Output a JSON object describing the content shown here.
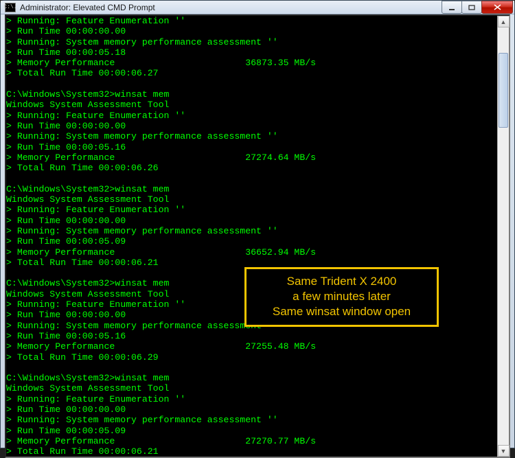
{
  "window": {
    "title": "Administrator: Elevated CMD Prompt",
    "icon_text": "C:\\."
  },
  "annotation": {
    "line1": "Same Trident X 2400",
    "line2": "a few minutes later",
    "line3": "Same winsat window open"
  },
  "runs": [
    {
      "prompt": null,
      "tool_line": null,
      "feat_time": "00:00:00.00",
      "assess_time": "00:00:05.18",
      "mem_perf": "36873.35 MB/s",
      "total_time": "00:00:06.27"
    },
    {
      "prompt": "C:\\Windows\\System32>winsat mem",
      "tool_line": "Windows System Assessment Tool",
      "feat_time": "00:00:00.00",
      "assess_time": "00:00:05.16",
      "mem_perf": "27274.64 MB/s",
      "total_time": "00:00:06.26"
    },
    {
      "prompt": "C:\\Windows\\System32>winsat mem",
      "tool_line": "Windows System Assessment Tool",
      "feat_time": "00:00:00.00",
      "assess_time": "00:00:05.09",
      "mem_perf": "36652.94 MB/s",
      "total_time": "00:00:06.21"
    },
    {
      "prompt": "C:\\Windows\\System32>winsat mem",
      "tool_line": "Windows System Assessment Tool",
      "feat_time": "00:00:00.00",
      "assess_time": "00:00:05.16",
      "mem_perf": "27255.48 MB/s",
      "total_time": "00:00:06.29"
    },
    {
      "prompt": "C:\\Windows\\System32>winsat mem",
      "tool_line": "Windows System Assessment Tool",
      "feat_time": "00:00:00.00",
      "assess_time": "00:00:05.09",
      "mem_perf": "27270.77 MB/s",
      "total_time": "00:00:06.21"
    }
  ],
  "labels": {
    "feature_enum": "> Running: Feature Enumeration ''",
    "run_time_prefix": "> Run Time ",
    "sys_mem": "> Running: System memory performance assessment ''",
    "mem_perf_label": "> Memory Performance                        ",
    "total_prefix": "> Total Run Time "
  }
}
